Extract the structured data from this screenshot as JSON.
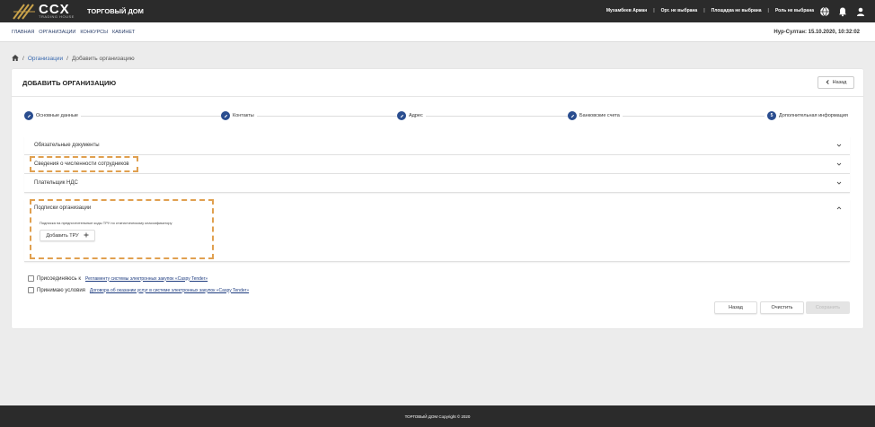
{
  "brand": {
    "logo_text": "CCX",
    "logo_sub": "TRADING HOUSE",
    "title": "ТОРГОВЫЙ ДОМ"
  },
  "header": {
    "user": "Мухамбеев Арман",
    "org": "Орг. не выбрана",
    "platform": "Площадка не выбрана",
    "role": "Роль не выбрана",
    "icons": [
      "globe-icon",
      "bell-icon",
      "user-icon"
    ]
  },
  "nav": {
    "links": [
      "ГЛАВНАЯ",
      "ОРГАНИЗАЦИИ",
      "КОНКУРСЫ",
      "КАБИНЕТ"
    ],
    "datetime": "Нур-Султан: 15.10.2020, 10:32:02"
  },
  "breadcrumb": {
    "home_icon": "home-icon",
    "items": [
      "Организации",
      "Добавить организацию"
    ]
  },
  "page": {
    "title": "ДОБАВИТЬ ОРГАНИЗАЦИЮ",
    "back_label": "Назад"
  },
  "stepper": {
    "steps": [
      {
        "label": "Основные данные",
        "state": "done"
      },
      {
        "label": "Контакты",
        "state": "done"
      },
      {
        "label": "Адрес",
        "state": "done"
      },
      {
        "label": "Банковские счета",
        "state": "done"
      },
      {
        "label": "Дополнительная информация",
        "state": "current",
        "number": "5"
      }
    ]
  },
  "accordion": {
    "sections": [
      {
        "label": "Обязательные документы",
        "expanded": false
      },
      {
        "label": "Сведения о численности сотрудников",
        "expanded": false
      },
      {
        "label": "Плательщик НДС",
        "expanded": false
      },
      {
        "label": "Подписки организации",
        "expanded": true
      }
    ],
    "subscription_note": "Подписка на предпочтительные коды ТРУ по статистическому классификатору",
    "add_button": "Добавить ТРУ"
  },
  "agreements": {
    "join_label": "Присоединяюсь к",
    "join_doc": "Регламенту системы электронных закупок «Caspy Tender»",
    "accept_label": "Принимаю условия",
    "accept_doc": "Договора об оказании услуг в системе электронных закупок «Caspy Tender»"
  },
  "actions": {
    "back": "Назад",
    "clear": "Очистить",
    "save": "Сохранить"
  },
  "footer": {
    "text": "ТОРГОВЫЙ ДОМ Copyright © 2020"
  },
  "colors": {
    "topbar": "#2b2b2b",
    "step_accent": "#2a4d8f",
    "highlight": "#e0a050"
  }
}
